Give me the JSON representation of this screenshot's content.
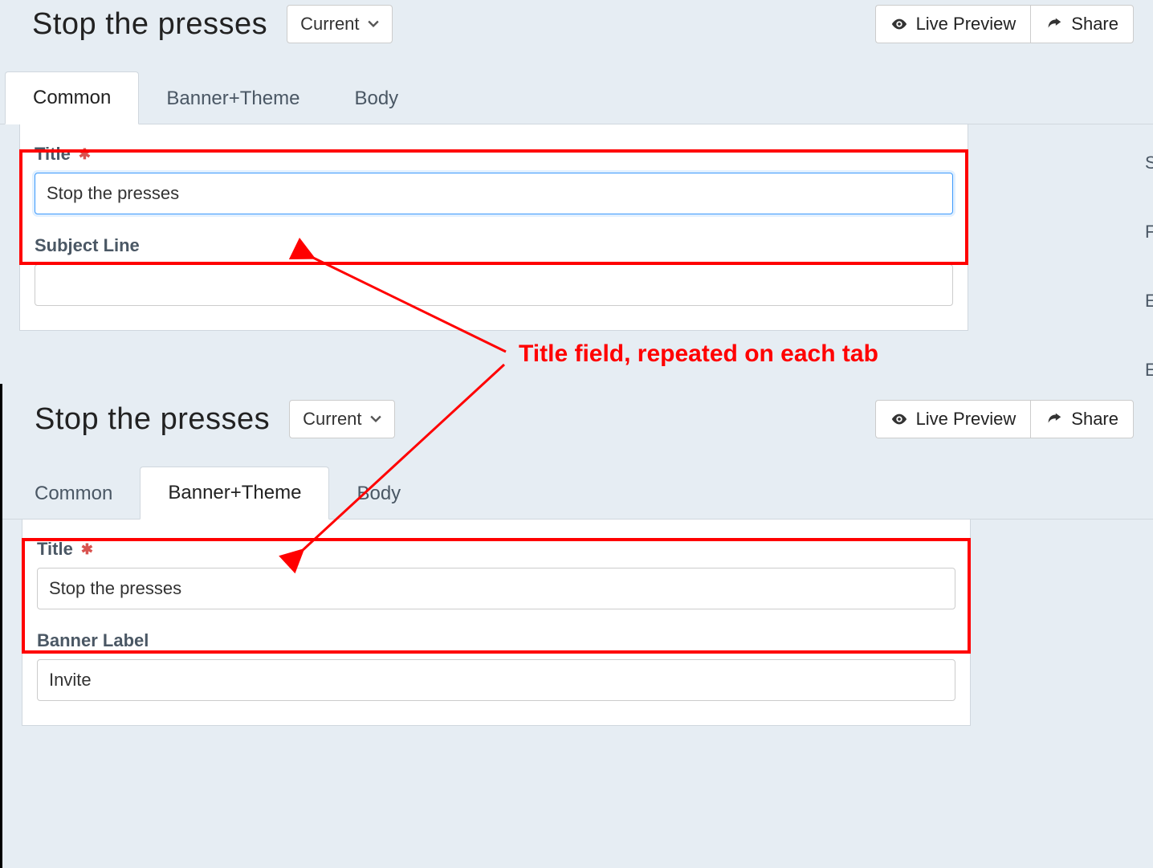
{
  "annotation": {
    "text": "Title field, repeated on each tab"
  },
  "panel1": {
    "page_title": "Stop the presses",
    "dropdown_label": "Current",
    "live_preview": "Live Preview",
    "share": "Share",
    "tabs": {
      "common": "Common",
      "banner": "Banner+Theme",
      "body": "Body"
    },
    "title_label": "Title",
    "title_value": "Stop the presses",
    "subject_label": "Subject Line",
    "subject_value": ""
  },
  "panel2": {
    "page_title": "Stop the presses",
    "dropdown_label": "Current",
    "live_preview": "Live Preview",
    "share": "Share",
    "tabs": {
      "common": "Common",
      "banner": "Banner+Theme",
      "body": "Body"
    },
    "title_label": "Title",
    "title_value": "Stop the presses",
    "banner_label_label": "Banner Label",
    "banner_label_value": "Invite"
  },
  "sidebar_chars": {
    "a": "S",
    "b": "F",
    "c": "E",
    "d": "E"
  }
}
